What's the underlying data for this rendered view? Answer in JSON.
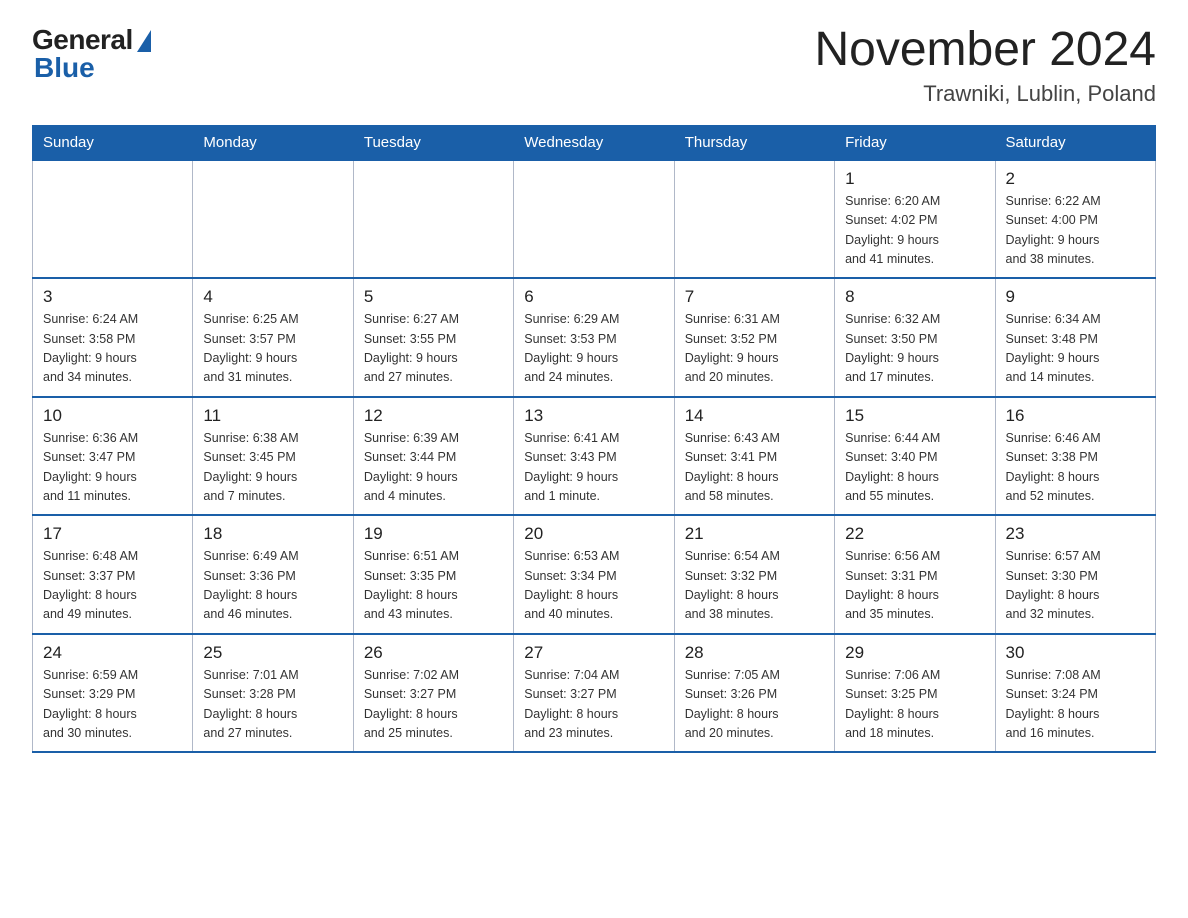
{
  "header": {
    "logo_general": "General",
    "logo_blue": "Blue",
    "month_title": "November 2024",
    "location": "Trawniki, Lublin, Poland"
  },
  "days_of_week": [
    "Sunday",
    "Monday",
    "Tuesday",
    "Wednesday",
    "Thursday",
    "Friday",
    "Saturday"
  ],
  "weeks": [
    {
      "days": [
        {
          "day": "",
          "info": ""
        },
        {
          "day": "",
          "info": ""
        },
        {
          "day": "",
          "info": ""
        },
        {
          "day": "",
          "info": ""
        },
        {
          "day": "",
          "info": ""
        },
        {
          "day": "1",
          "info": "Sunrise: 6:20 AM\nSunset: 4:02 PM\nDaylight: 9 hours\nand 41 minutes."
        },
        {
          "day": "2",
          "info": "Sunrise: 6:22 AM\nSunset: 4:00 PM\nDaylight: 9 hours\nand 38 minutes."
        }
      ]
    },
    {
      "days": [
        {
          "day": "3",
          "info": "Sunrise: 6:24 AM\nSunset: 3:58 PM\nDaylight: 9 hours\nand 34 minutes."
        },
        {
          "day": "4",
          "info": "Sunrise: 6:25 AM\nSunset: 3:57 PM\nDaylight: 9 hours\nand 31 minutes."
        },
        {
          "day": "5",
          "info": "Sunrise: 6:27 AM\nSunset: 3:55 PM\nDaylight: 9 hours\nand 27 minutes."
        },
        {
          "day": "6",
          "info": "Sunrise: 6:29 AM\nSunset: 3:53 PM\nDaylight: 9 hours\nand 24 minutes."
        },
        {
          "day": "7",
          "info": "Sunrise: 6:31 AM\nSunset: 3:52 PM\nDaylight: 9 hours\nand 20 minutes."
        },
        {
          "day": "8",
          "info": "Sunrise: 6:32 AM\nSunset: 3:50 PM\nDaylight: 9 hours\nand 17 minutes."
        },
        {
          "day": "9",
          "info": "Sunrise: 6:34 AM\nSunset: 3:48 PM\nDaylight: 9 hours\nand 14 minutes."
        }
      ]
    },
    {
      "days": [
        {
          "day": "10",
          "info": "Sunrise: 6:36 AM\nSunset: 3:47 PM\nDaylight: 9 hours\nand 11 minutes."
        },
        {
          "day": "11",
          "info": "Sunrise: 6:38 AM\nSunset: 3:45 PM\nDaylight: 9 hours\nand 7 minutes."
        },
        {
          "day": "12",
          "info": "Sunrise: 6:39 AM\nSunset: 3:44 PM\nDaylight: 9 hours\nand 4 minutes."
        },
        {
          "day": "13",
          "info": "Sunrise: 6:41 AM\nSunset: 3:43 PM\nDaylight: 9 hours\nand 1 minute."
        },
        {
          "day": "14",
          "info": "Sunrise: 6:43 AM\nSunset: 3:41 PM\nDaylight: 8 hours\nand 58 minutes."
        },
        {
          "day": "15",
          "info": "Sunrise: 6:44 AM\nSunset: 3:40 PM\nDaylight: 8 hours\nand 55 minutes."
        },
        {
          "day": "16",
          "info": "Sunrise: 6:46 AM\nSunset: 3:38 PM\nDaylight: 8 hours\nand 52 minutes."
        }
      ]
    },
    {
      "days": [
        {
          "day": "17",
          "info": "Sunrise: 6:48 AM\nSunset: 3:37 PM\nDaylight: 8 hours\nand 49 minutes."
        },
        {
          "day": "18",
          "info": "Sunrise: 6:49 AM\nSunset: 3:36 PM\nDaylight: 8 hours\nand 46 minutes."
        },
        {
          "day": "19",
          "info": "Sunrise: 6:51 AM\nSunset: 3:35 PM\nDaylight: 8 hours\nand 43 minutes."
        },
        {
          "day": "20",
          "info": "Sunrise: 6:53 AM\nSunset: 3:34 PM\nDaylight: 8 hours\nand 40 minutes."
        },
        {
          "day": "21",
          "info": "Sunrise: 6:54 AM\nSunset: 3:32 PM\nDaylight: 8 hours\nand 38 minutes."
        },
        {
          "day": "22",
          "info": "Sunrise: 6:56 AM\nSunset: 3:31 PM\nDaylight: 8 hours\nand 35 minutes."
        },
        {
          "day": "23",
          "info": "Sunrise: 6:57 AM\nSunset: 3:30 PM\nDaylight: 8 hours\nand 32 minutes."
        }
      ]
    },
    {
      "days": [
        {
          "day": "24",
          "info": "Sunrise: 6:59 AM\nSunset: 3:29 PM\nDaylight: 8 hours\nand 30 minutes."
        },
        {
          "day": "25",
          "info": "Sunrise: 7:01 AM\nSunset: 3:28 PM\nDaylight: 8 hours\nand 27 minutes."
        },
        {
          "day": "26",
          "info": "Sunrise: 7:02 AM\nSunset: 3:27 PM\nDaylight: 8 hours\nand 25 minutes."
        },
        {
          "day": "27",
          "info": "Sunrise: 7:04 AM\nSunset: 3:27 PM\nDaylight: 8 hours\nand 23 minutes."
        },
        {
          "day": "28",
          "info": "Sunrise: 7:05 AM\nSunset: 3:26 PM\nDaylight: 8 hours\nand 20 minutes."
        },
        {
          "day": "29",
          "info": "Sunrise: 7:06 AM\nSunset: 3:25 PM\nDaylight: 8 hours\nand 18 minutes."
        },
        {
          "day": "30",
          "info": "Sunrise: 7:08 AM\nSunset: 3:24 PM\nDaylight: 8 hours\nand 16 minutes."
        }
      ]
    }
  ]
}
